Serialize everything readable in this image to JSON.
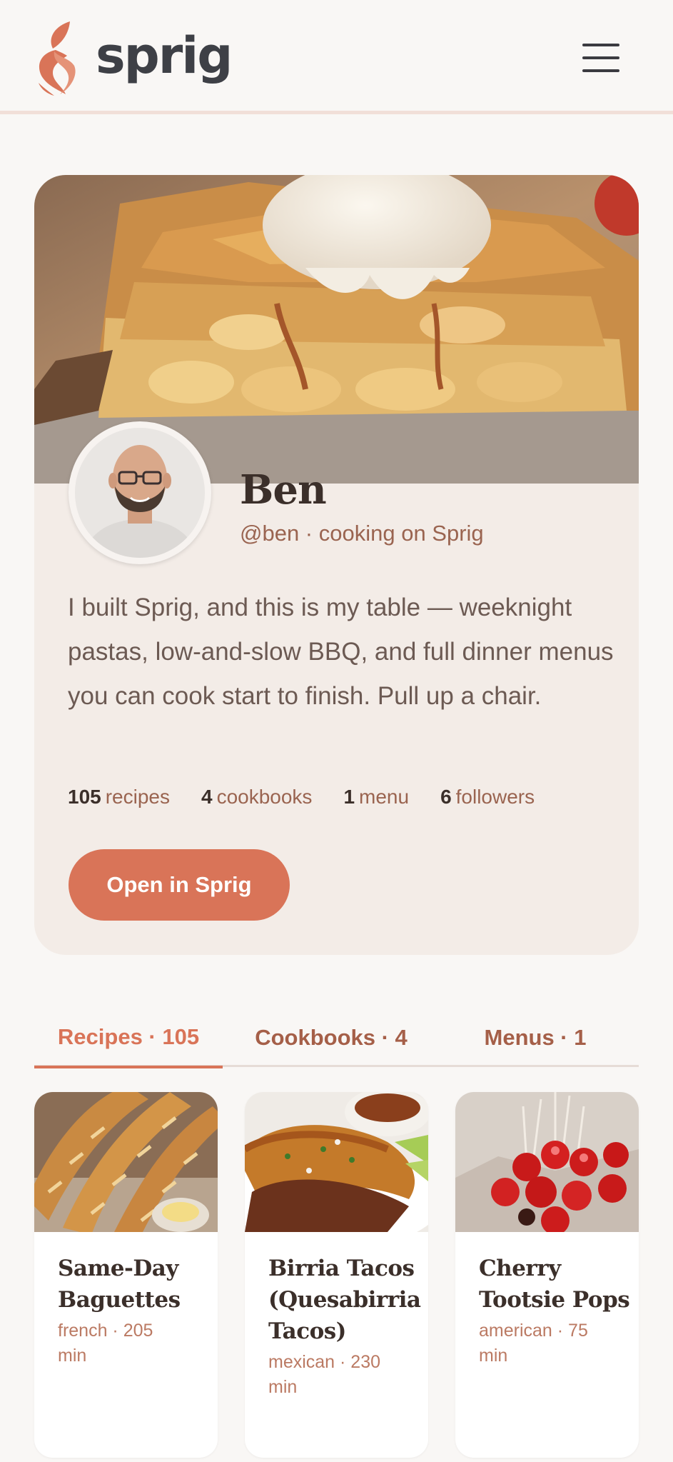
{
  "header": {
    "logo_text": "sprig",
    "brand_color": "#d97458"
  },
  "profile": {
    "name": "Ben",
    "handle_line": "@ben · cooking on Sprig",
    "bio": "I built Sprig, and this is my table — weeknight pastas, low-and-slow BBQ, and full dinner menus you can cook start to finish. Pull up a chair.",
    "stats": [
      {
        "num": "105",
        "label": "recipes"
      },
      {
        "num": "4",
        "label": "cookbooks"
      },
      {
        "num": "1",
        "label": "menu"
      },
      {
        "num": "6",
        "label": "followers"
      }
    ],
    "open_button": "Open in Sprig"
  },
  "tabs": [
    {
      "label": "Recipes · 105",
      "active": true
    },
    {
      "label": "Cookbooks · 4",
      "active": false
    },
    {
      "label": "Menus · 1",
      "active": false
    }
  ],
  "recipes": [
    {
      "title": "Same-Day Baguettes",
      "meta": "french · 205 min"
    },
    {
      "title": "Birria Tacos (Quesabirria Tacos)",
      "meta": "mexican · 230 min"
    },
    {
      "title": "Cherry Tootsie Pops",
      "meta": "american · 75 min"
    }
  ],
  "icons": {
    "logo": "sprig-leaf-icon",
    "menu": "hamburger-menu-icon"
  }
}
